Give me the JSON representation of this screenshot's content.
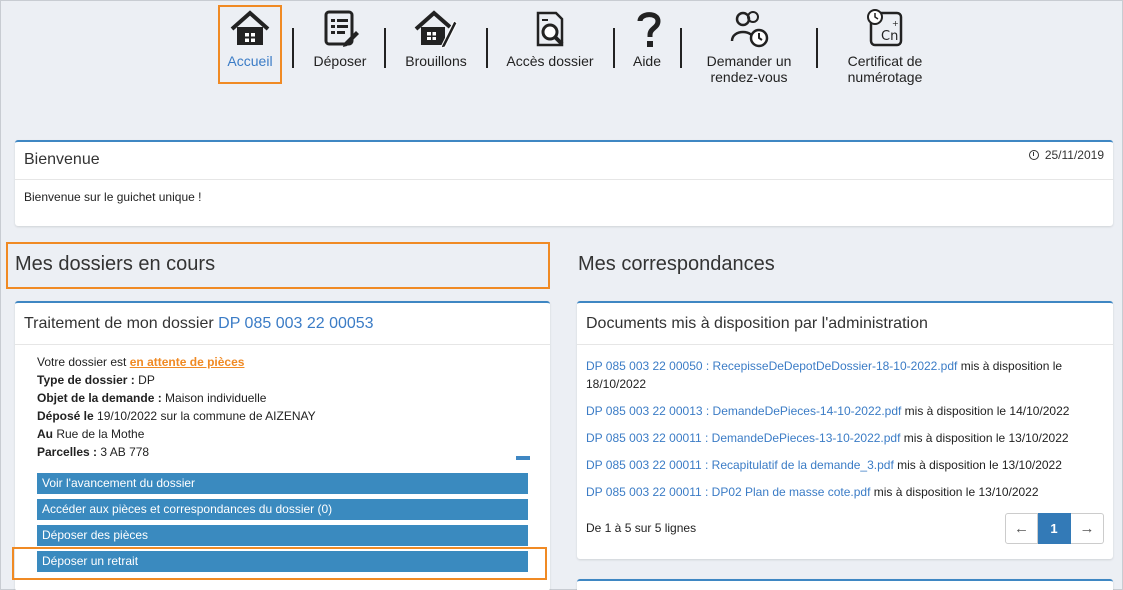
{
  "nav": {
    "items": [
      {
        "label": "Accueil",
        "icon": "house-icon"
      },
      {
        "label": "Déposer",
        "icon": "form-edit-icon"
      },
      {
        "label": "Brouillons",
        "icon": "house-pen-icon"
      },
      {
        "label": "Accès dossier",
        "icon": "folder-search-icon"
      },
      {
        "label": "Aide",
        "icon": "question-mark-icon"
      },
      {
        "label": "Demander un rendez-vous",
        "label_line1": "Demander un",
        "label_line2": "rendez-vous",
        "icon": "people-clock-icon"
      },
      {
        "label": "Certificat de numérotage",
        "label_line1": "Certificat de",
        "label_line2": "numérotage",
        "icon": "clock-cn-icon"
      }
    ]
  },
  "welcome": {
    "title": "Bienvenue",
    "date": "25/11/2019",
    "message": "Bienvenue sur le guichet unique !"
  },
  "dossiers": {
    "section_title": "Mes dossiers en cours",
    "panel_title": "Traitement de mon dossier",
    "dossier_number": "DP 085 003 22 00053",
    "status_prefix": "Votre dossier est",
    "status": "en attente de pièces",
    "type_label": "Type de dossier :",
    "type_value": "DP",
    "objet_label": "Objet de la demande :",
    "objet_value": "Maison individuelle",
    "depose_label": "Déposé le",
    "depose_value": "19/10/2022 sur la commune de AIZENAY",
    "au_label": "Au",
    "au_value": "Rue de la Mothe",
    "parcelles_label": "Parcelles :",
    "parcelles_value": "3 AB 778",
    "actions": [
      "Voir l'avancement du dossier",
      "Accéder aux pièces et correspondances du dossier (0)",
      "Déposer des pièces",
      "Déposer un retrait"
    ]
  },
  "correspondances": {
    "section_title": "Mes correspondances",
    "panel_title": "Documents mis à disposition par l'administration",
    "documents": [
      {
        "link": "DP 085 003 22 00050 : RecepisseDeDepotDeDossier-18-10-2022.pdf",
        "suffix": " mis à disposition le 18/10/2022"
      },
      {
        "link": "DP 085 003 22 00013 : DemandeDePieces-14-10-2022.pdf",
        "suffix": " mis à disposition le 14/10/2022"
      },
      {
        "link": "DP 085 003 22 00011 : DemandeDePieces-13-10-2022.pdf",
        "suffix": " mis à disposition le 13/10/2022"
      },
      {
        "link": "DP 085 003 22 00011 : Recapitulatif de la demande_3.pdf",
        "suffix": " mis à disposition le 13/10/2022"
      },
      {
        "link": "DP 085 003 22 00011 : DP02 Plan de masse cote.pdf",
        "suffix": " mis à disposition le 13/10/2022"
      }
    ],
    "footer": "De 1 à 5 sur 5 lignes",
    "pager": {
      "prev": "←",
      "current": "1",
      "next": "→"
    }
  },
  "colors": {
    "accent": "#3b7cc6",
    "button": "#3a8abf",
    "highlight": "#f08a24",
    "background": "#eceff4"
  }
}
